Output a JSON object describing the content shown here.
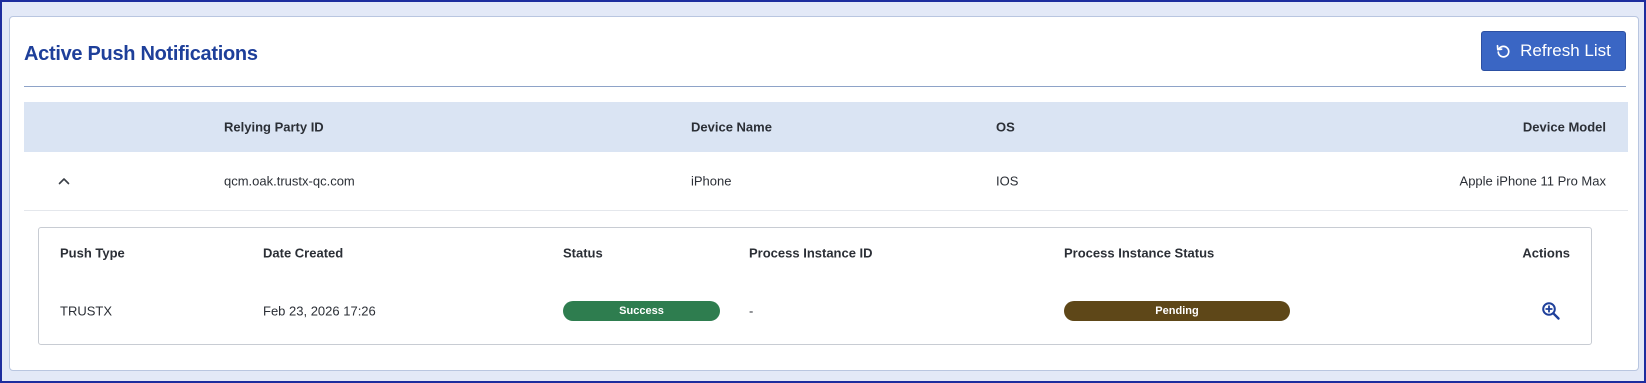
{
  "header": {
    "title": "Active Push Notifications",
    "refresh_label": "Refresh List"
  },
  "outer_table": {
    "columns": [
      "Relying Party ID",
      "Device Name",
      "OS",
      "Device Model"
    ],
    "row": {
      "relying_party_id": "qcm.oak.trustx-qc.com",
      "device_name": "iPhone",
      "os": "IOS",
      "device_model": "Apple iPhone 11 Pro Max",
      "expanded": true
    }
  },
  "inner_table": {
    "columns": [
      "Push Type",
      "Date Created",
      "Status",
      "Process Instance ID",
      "Process Instance Status",
      "Actions"
    ],
    "row": {
      "push_type": "TRUSTX",
      "date_created": "Feb 23, 2026 17:26",
      "status": "Success",
      "process_instance_id": "-",
      "process_instance_status": "Pending",
      "action_icon": "zoom-in-icon"
    }
  },
  "colors": {
    "title": "#1e3f9a",
    "button": "#3a66c4",
    "success": "#2e7d4f",
    "pending": "#5e4718",
    "table_head": "#dae4f3"
  }
}
